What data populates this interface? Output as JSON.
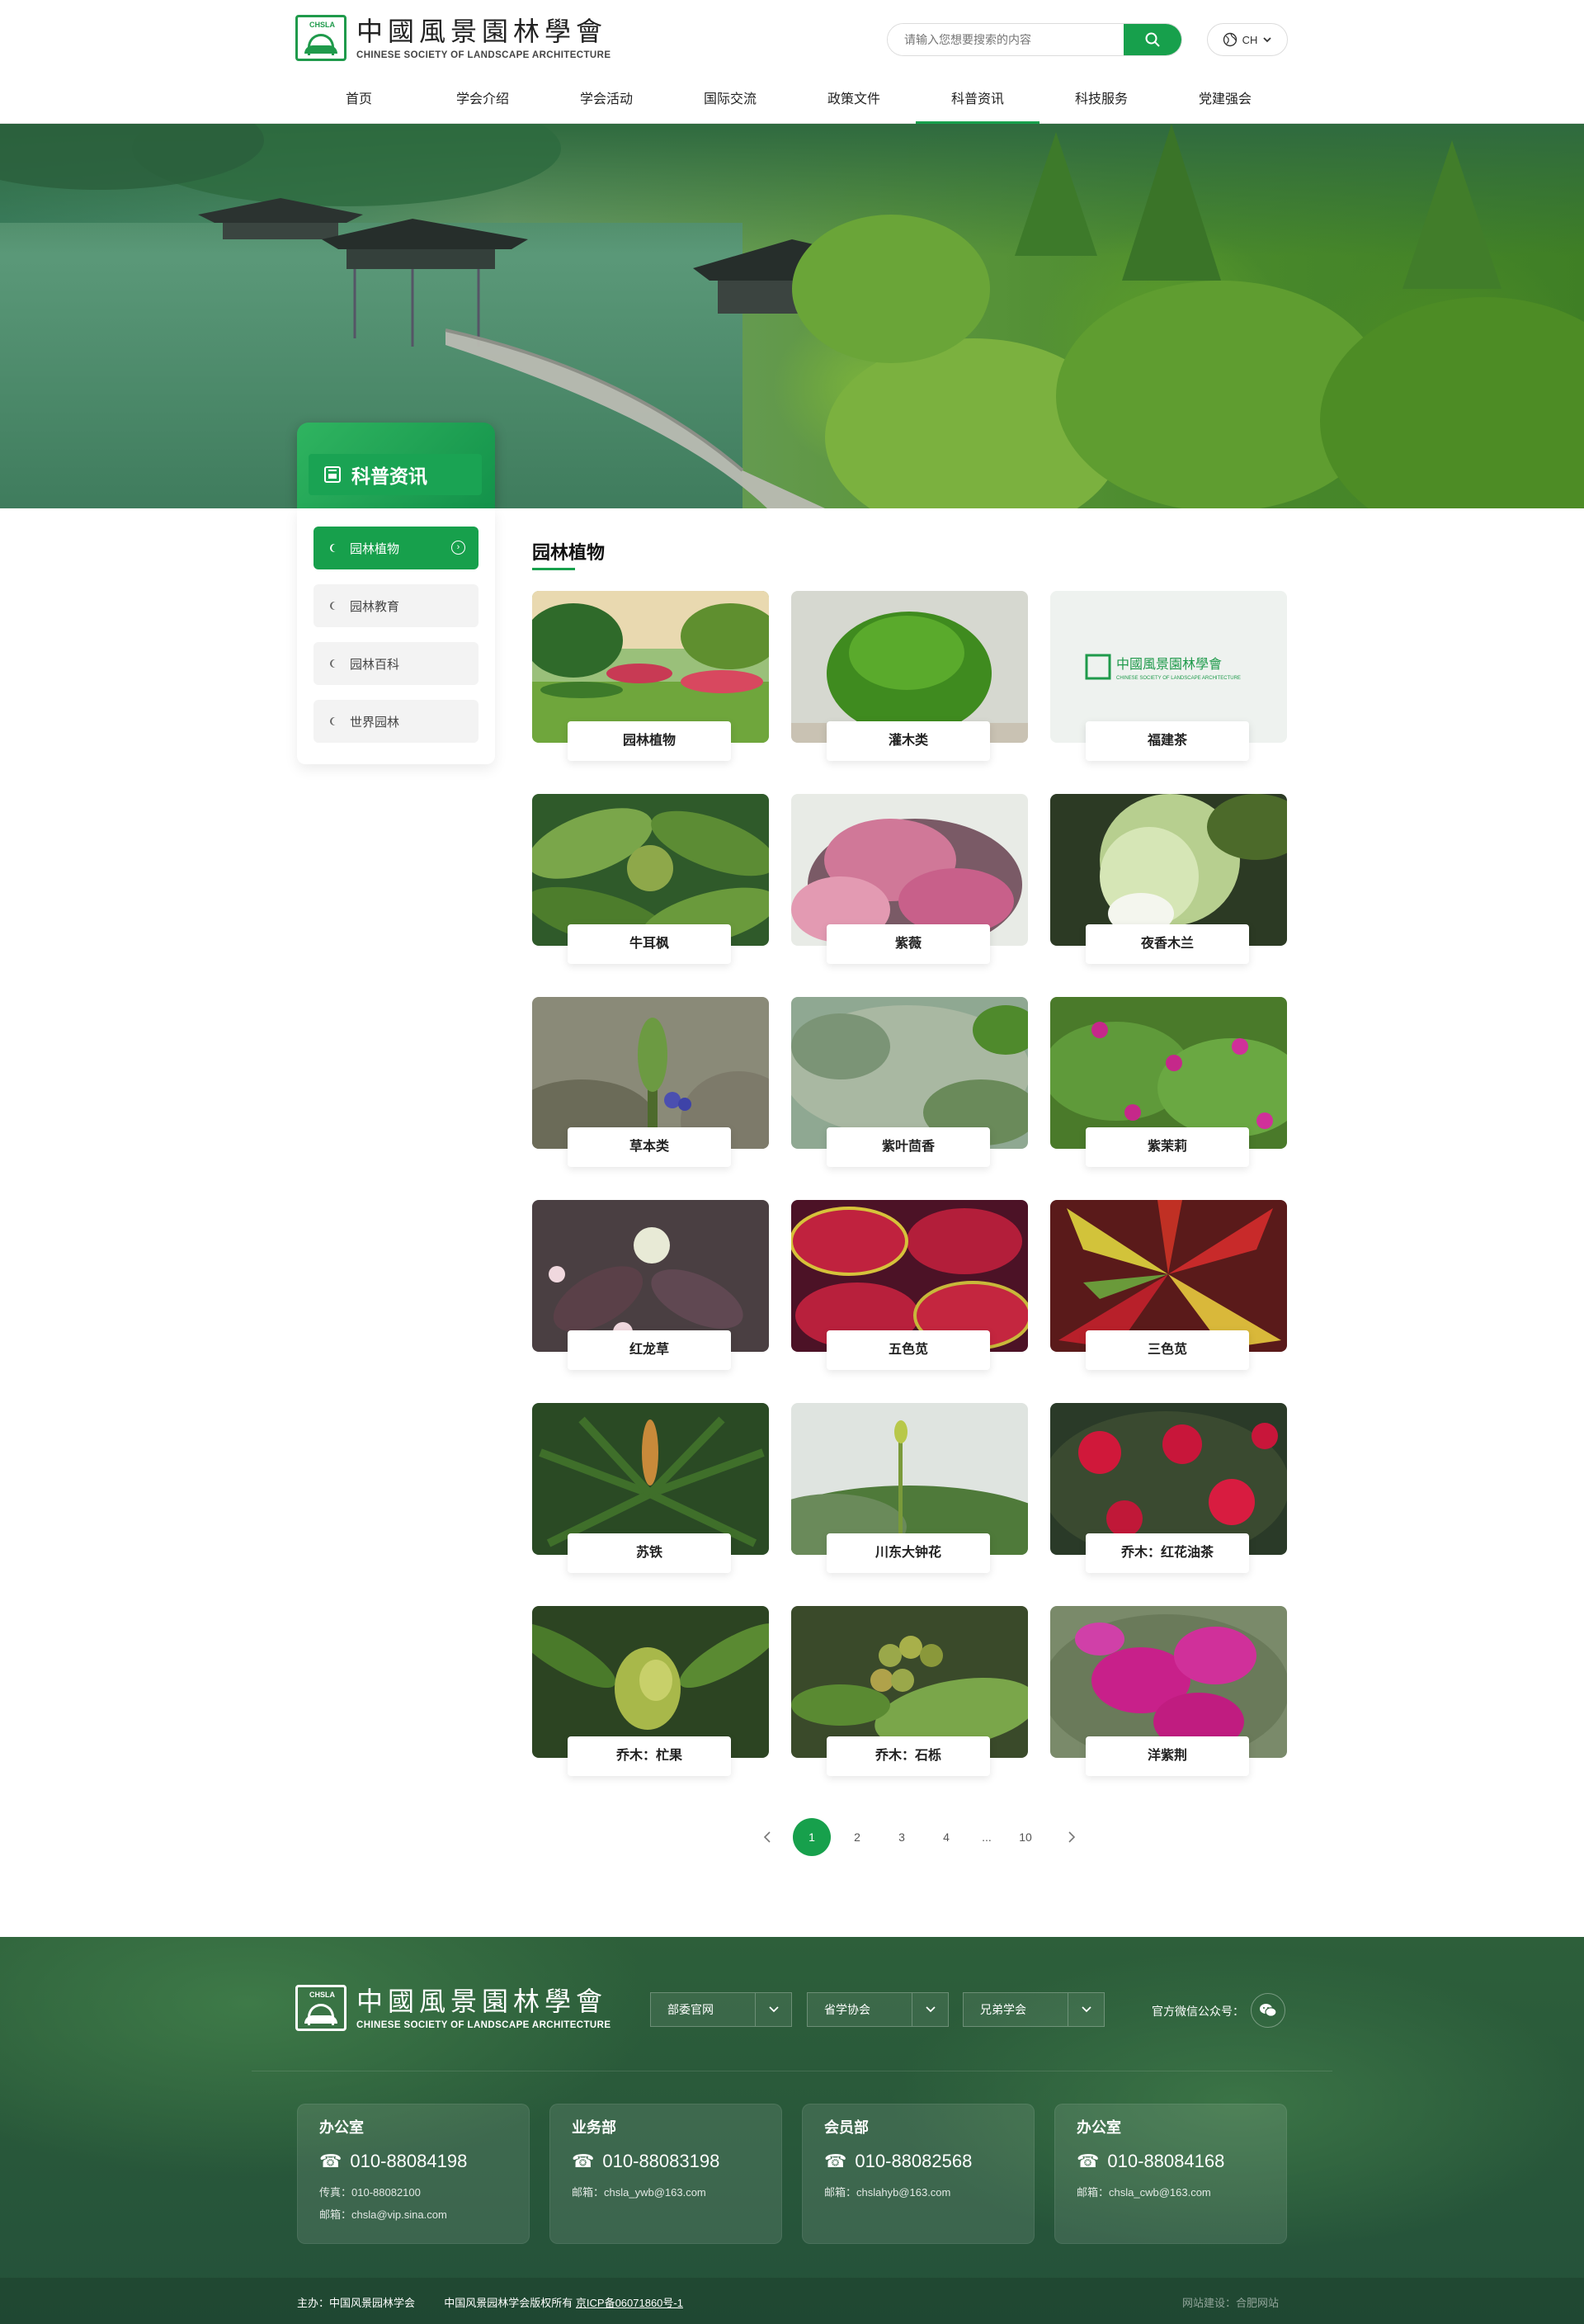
{
  "header": {
    "logo_cn": "中國風景園林學會",
    "logo_en": "CHINESE SOCIETY OF LANDSCAPE ARCHITECTURE",
    "logo_tag": "CHSLA",
    "search_placeholder": "请输入您想要搜索的内容",
    "lang": "CH"
  },
  "nav": [
    {
      "label": "首页"
    },
    {
      "label": "学会介绍"
    },
    {
      "label": "学会活动"
    },
    {
      "label": "国际交流"
    },
    {
      "label": "政策文件"
    },
    {
      "label": "科普资讯",
      "active": true
    },
    {
      "label": "科技服务"
    },
    {
      "label": "党建强会"
    }
  ],
  "banner": {
    "section_title": "科普资讯"
  },
  "sidebar": {
    "items": [
      {
        "label": "园林植物",
        "active": true
      },
      {
        "label": "园林教育"
      },
      {
        "label": "园林百科"
      },
      {
        "label": "世界园林"
      }
    ]
  },
  "content": {
    "title": "园林植物",
    "cards": [
      {
        "label": "园林植物",
        "scene": "garden"
      },
      {
        "label": "灌木类",
        "scene": "shrub"
      },
      {
        "label": "福建茶",
        "scene": "placeholder"
      },
      {
        "label": "牛耳枫",
        "scene": "leaves"
      },
      {
        "label": "紫薇",
        "scene": "pinkflowers"
      },
      {
        "label": "夜香木兰",
        "scene": "magnolia"
      },
      {
        "label": "草本类",
        "scene": "herb"
      },
      {
        "label": "紫叶茴香",
        "scene": "fennel"
      },
      {
        "label": "紫茉莉",
        "scene": "mirabilis"
      },
      {
        "label": "红龙草",
        "scene": "redweed"
      },
      {
        "label": "五色苋",
        "scene": "coleus"
      },
      {
        "label": "三色苋",
        "scene": "amaranth"
      },
      {
        "label": "苏铁",
        "scene": "cycad"
      },
      {
        "label": "川东大钟花",
        "scene": "bellflower"
      },
      {
        "label": "乔木：红花油茶",
        "scene": "camellia"
      },
      {
        "label": "乔木：杧果",
        "scene": "mango"
      },
      {
        "label": "乔木：石栎",
        "scene": "acorn"
      },
      {
        "label": "洋紫荆",
        "scene": "bauhinia"
      }
    ]
  },
  "pagination": {
    "pages": [
      "1",
      "2",
      "3",
      "4",
      "...",
      "10"
    ],
    "current": "1",
    "prev_icon": "chevron-left-icon",
    "next_icon": "chevron-right-icon"
  },
  "footer": {
    "logo_cn": "中國風景園林學會",
    "logo_en": "CHINESE SOCIETY OF LANDSCAPE ARCHITECTURE",
    "logo_tag": "CHSLA",
    "selects": [
      "部委官网",
      "省学协会",
      "兄弟学会"
    ],
    "wechat_label": "官方微信公众号：",
    "contacts": [
      {
        "title": "办公室",
        "phone": "010-88084198",
        "lines": [
          "传真：010-88082100",
          "邮箱：chsla@vip.sina.com"
        ]
      },
      {
        "title": "业务部",
        "phone": "010-88083198",
        "lines": [
          "邮箱：chsla_ywb@163.com"
        ]
      },
      {
        "title": "会员部",
        "phone": "010-88082568",
        "lines": [
          "邮箱：chslahyb@163.com"
        ]
      },
      {
        "title": "办公室",
        "phone": "010-88084168",
        "lines": [
          "邮箱：chsla_cwb@163.com"
        ]
      }
    ],
    "host": "主办：中国风景园林学会",
    "copyright": "中国风景园林学会版权所有",
    "icp": "京ICP备06071860号-1",
    "credit": "网站建设：合肥网站"
  },
  "colors": {
    "brand": "#17a04c",
    "footer_bg": "#2d5f3a"
  }
}
